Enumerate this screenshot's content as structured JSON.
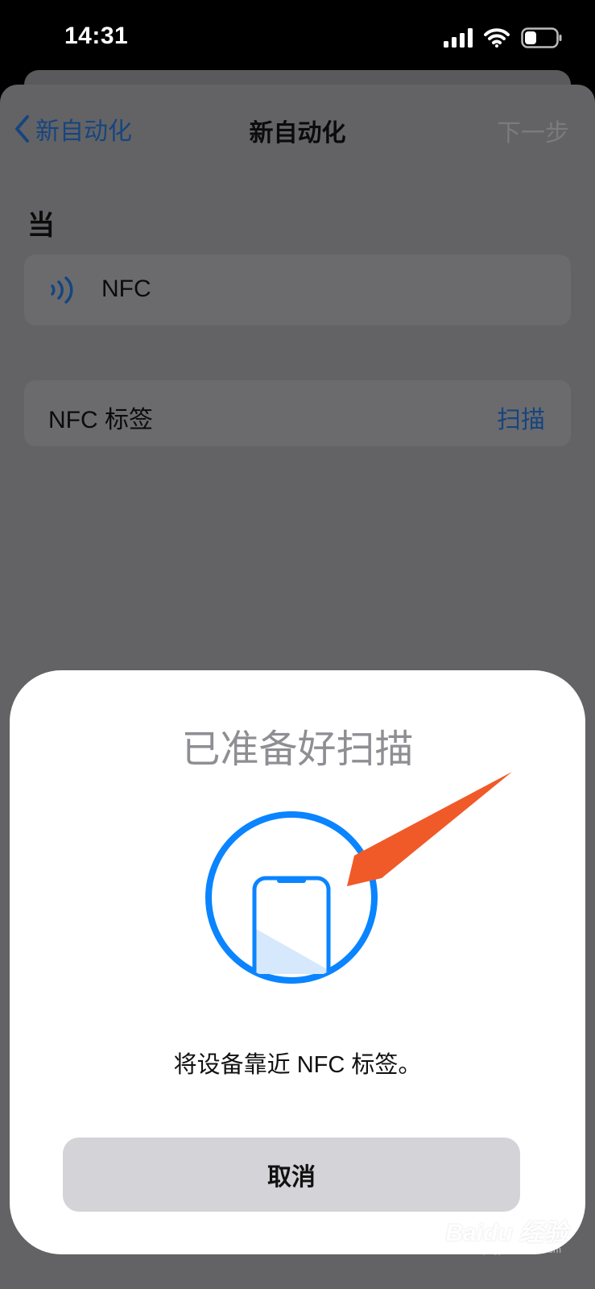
{
  "status_bar": {
    "time": "14:31"
  },
  "nav": {
    "back_label": "新自动化",
    "title": "新自动化",
    "next_label": "下一步"
  },
  "when_section": {
    "heading": "当",
    "trigger_label": "NFC",
    "trigger_icon": "nfc-waves-icon"
  },
  "tag_row": {
    "label": "NFC 标签",
    "scan_label": "扫描"
  },
  "scan_sheet": {
    "title": "已准备好扫描",
    "instruction": "将设备靠近 NFC 标签。",
    "cancel_label": "取消",
    "illustration_icon": "phone-in-circle-icon"
  },
  "watermark": {
    "text": "Baidu 经验",
    "subtext": "jingyan.baidu.com"
  },
  "colors": {
    "accent_blue": "#0a84ff",
    "link_blue_dimmed": "#16457f",
    "annotation_arrow": "#f05a28",
    "sheet_background": "#ffffff",
    "dimmed_background": "#636365"
  }
}
